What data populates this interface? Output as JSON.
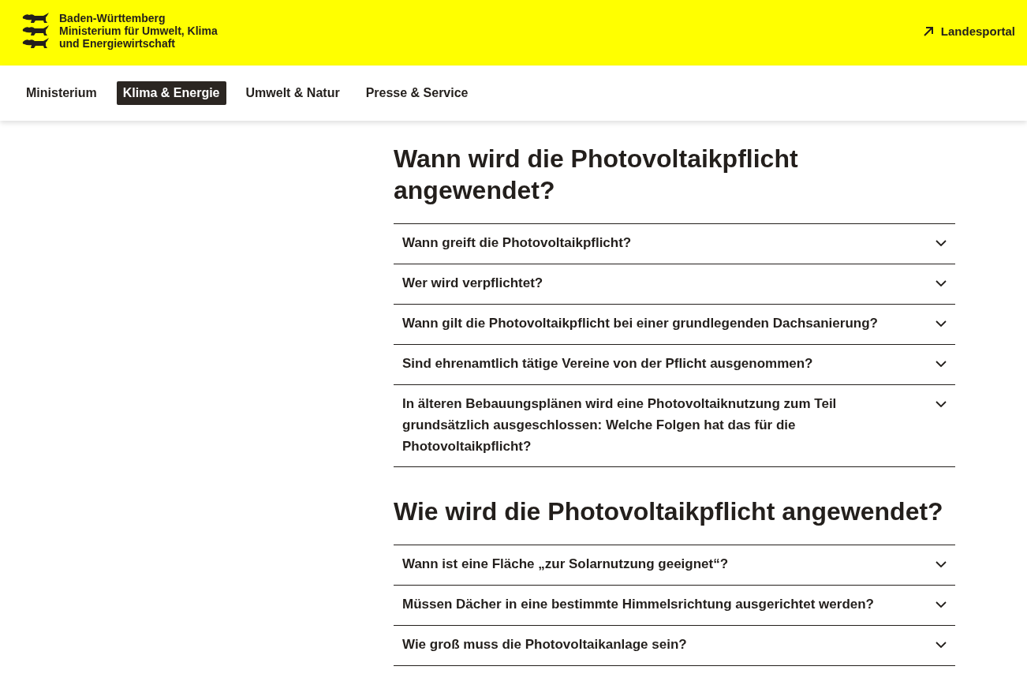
{
  "header": {
    "logo_lines": [
      "Baden-Württemberg",
      "Ministerium für Umwelt, Klima",
      "und Energiewirtschaft"
    ],
    "portal_link": "Landesportal"
  },
  "nav": [
    {
      "label": "Ministerium",
      "selected": false
    },
    {
      "label": "Klima & Energie",
      "selected": true
    },
    {
      "label": "Umwelt & Natur",
      "selected": false
    },
    {
      "label": "Presse & Service",
      "selected": false
    }
  ],
  "sections": [
    {
      "heading": "Wann wird die Photovoltaikpflicht angewendet?",
      "questions": [
        {
          "text": "Wann greift die Photovoltaikpflicht?",
          "expanded": false
        },
        {
          "text": "Wer wird verpflichtet?",
          "expanded": false
        },
        {
          "text": "Wann gilt die Photovoltaikpflicht bei einer grundlegenden Dachsanierung?",
          "expanded": false
        },
        {
          "text": "Sind ehrenamtlich tätige Vereine von der Pflicht ausgenommen?",
          "expanded": false
        },
        {
          "text": "In älteren Bebauungsplänen wird eine Photovoltaiknutzung zum Teil grundsätzlich ausgeschlossen: Welche Folgen hat das für die Photovoltaikpflicht?",
          "expanded": false
        }
      ]
    },
    {
      "heading": "Wie wird die Photovoltaikpflicht angewendet?",
      "questions": [
        {
          "text": "Wann ist eine Fläche „zur Solarnutzung geeignet“?",
          "expanded": false
        },
        {
          "text": "Müssen Dächer in eine bestimmte Himmelsrichtung ausgerichtet werden?",
          "expanded": false
        },
        {
          "text": "Wie groß muss die Photovoltaikanlage sein?",
          "expanded": false
        }
      ]
    }
  ]
}
